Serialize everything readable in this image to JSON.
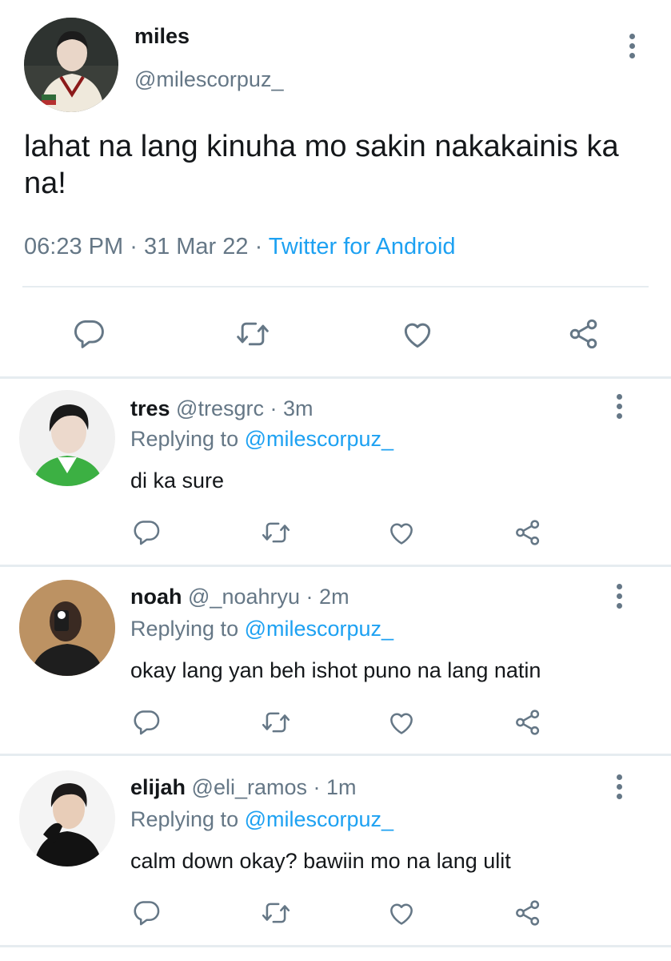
{
  "main_tweet": {
    "name": "miles",
    "handle": "@milescorpuz_",
    "text": "lahat na lang kinuha mo sakin nakakainis ka na!",
    "time": "06:23 PM",
    "sep": "·",
    "date": "31 Mar 22",
    "source": "Twitter for Android"
  },
  "replies": [
    {
      "name": "tres",
      "handle": "@tresgrc",
      "dot": "·",
      "time": "3m",
      "replying_label": "Replying to",
      "replying_user": "@milescorpuz_",
      "text": "di ka sure"
    },
    {
      "name": "noah",
      "handle": "@_noahryu",
      "dot": "·",
      "time": "2m",
      "replying_label": "Replying to",
      "replying_user": "@milescorpuz_",
      "text": "okay lang yan beh ishot puno na lang natin"
    },
    {
      "name": "elijah",
      "handle": "@eli_ramos",
      "dot": "·",
      "time": "1m",
      "replying_label": "Replying to",
      "replying_user": "@milescorpuz_",
      "text": "calm down okay? bawiin mo na lang ulit"
    }
  ],
  "icons": {
    "more": "more-vertical-icon",
    "reply": "comment-icon",
    "retweet": "retweet-icon",
    "like": "heart-icon",
    "share": "share-icon"
  },
  "colors": {
    "text": "#14171a",
    "secondary": "#657786",
    "link": "#1da1f2",
    "divider": "#e6ecf0"
  }
}
